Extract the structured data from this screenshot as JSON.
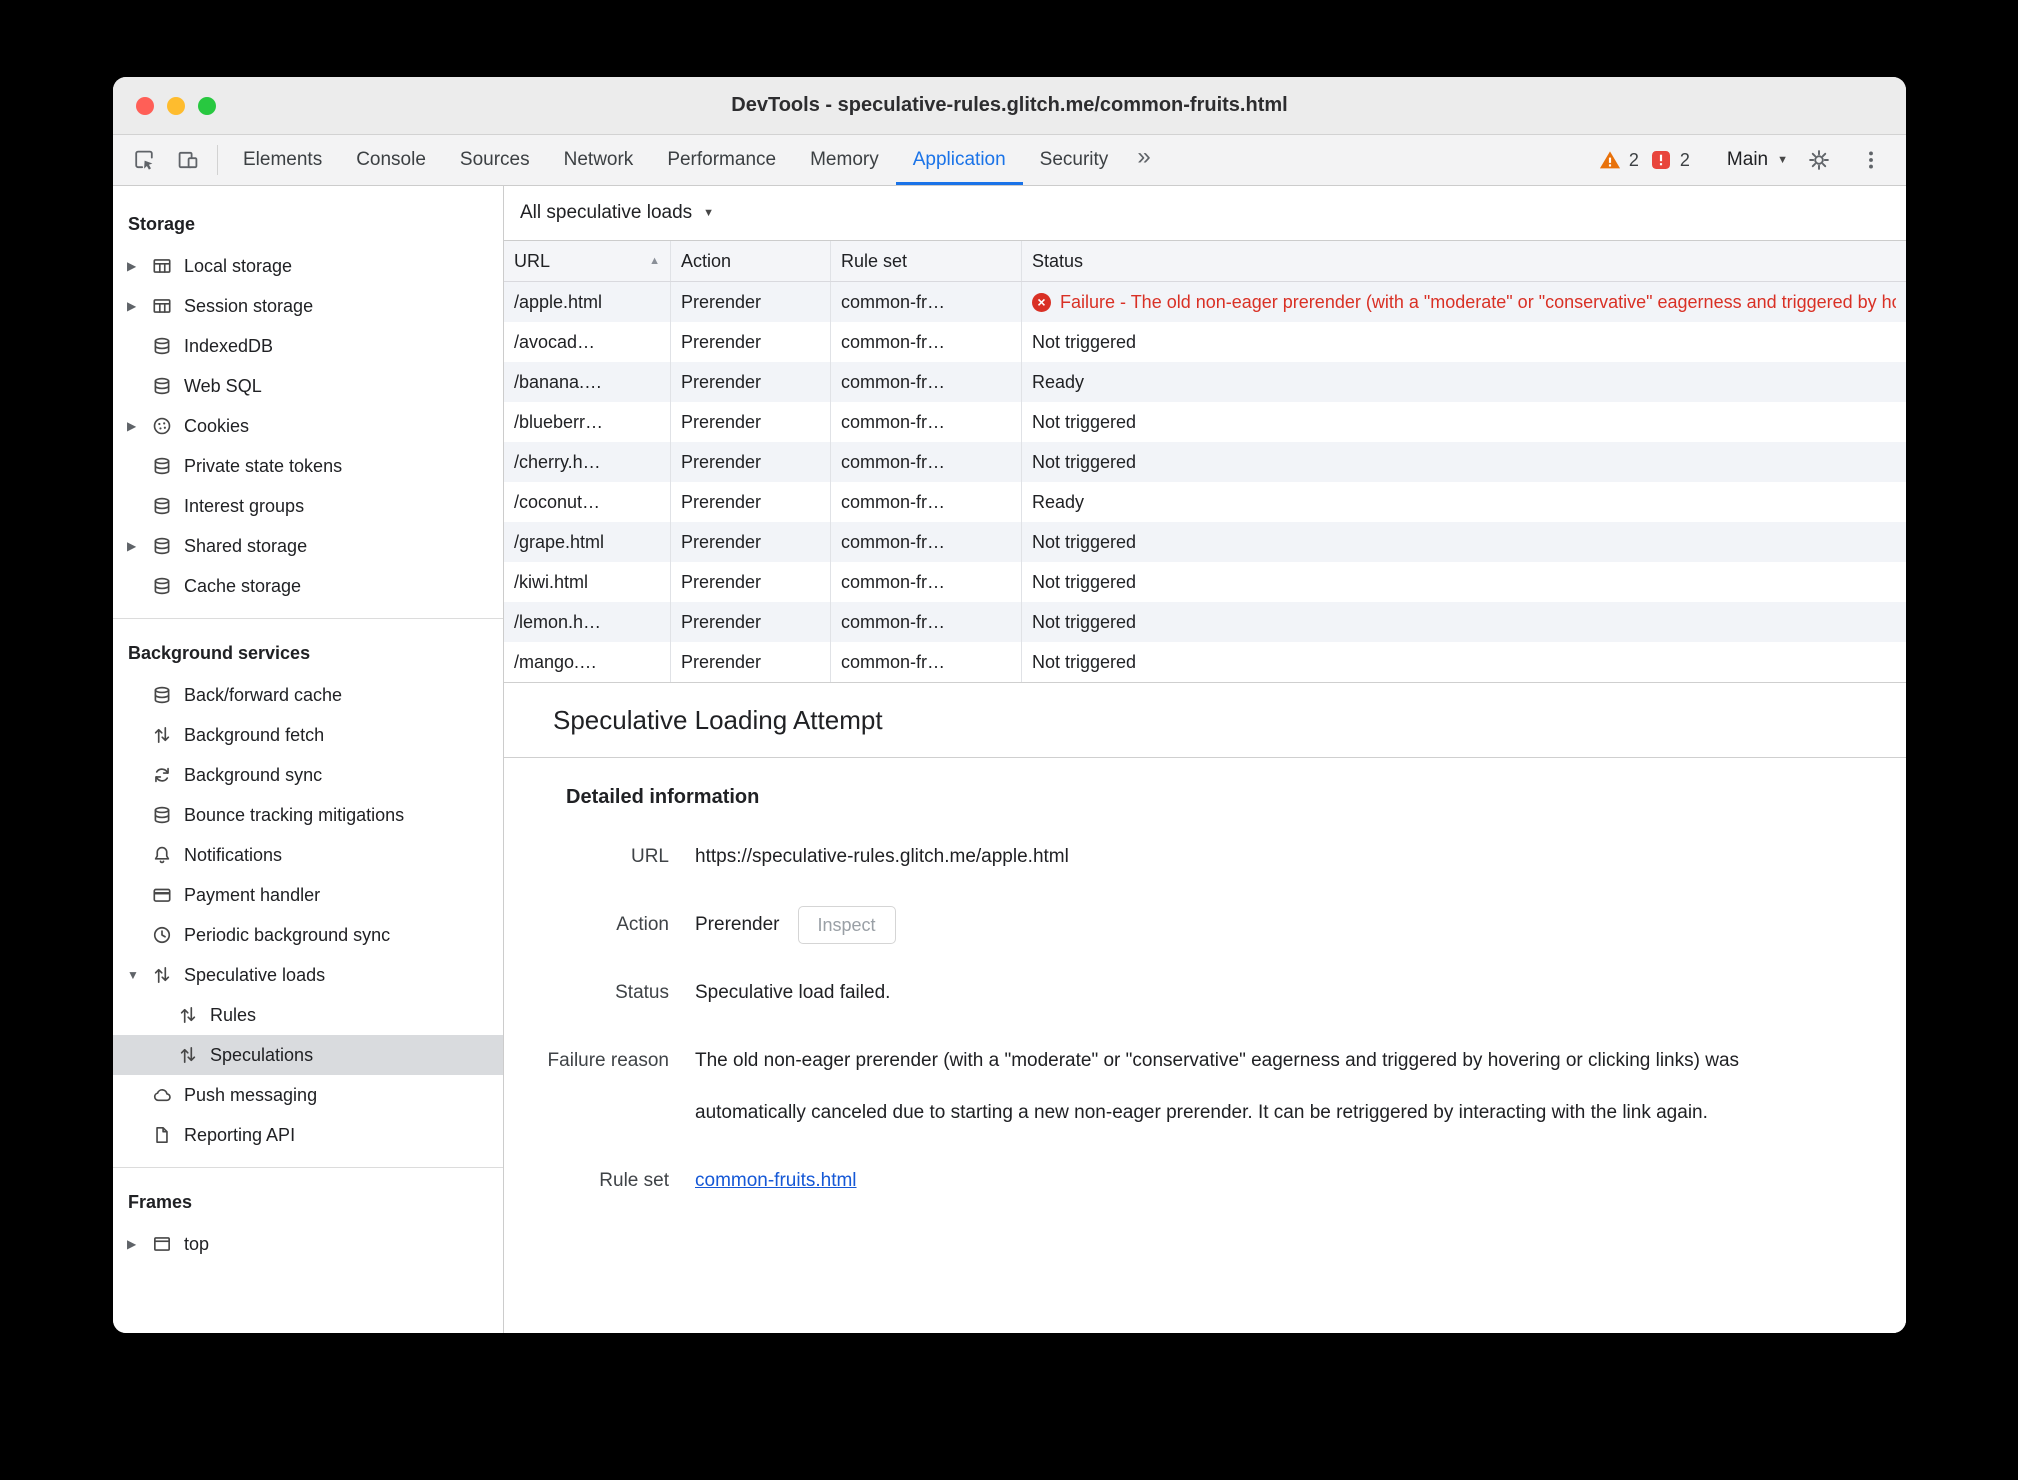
{
  "window": {
    "title": "DevTools - speculative-rules.glitch.me/common-fruits.html"
  },
  "toolbar": {
    "tabs": [
      "Elements",
      "Console",
      "Sources",
      "Network",
      "Performance",
      "Memory",
      "Application",
      "Security"
    ],
    "active_tab": "Application",
    "warning_count": "2",
    "issue_count": "2",
    "main_menu_label": "Main"
  },
  "icons": {
    "sort_ascending": "▲",
    "dropdown_caret": "▼",
    "collapsed_chevron": "▶",
    "expanded_chevron": "▼",
    "failure_x": "×",
    "overflow_chevron": "»",
    "main_caret": "▼"
  },
  "sidebar": {
    "storage": {
      "header": "Storage",
      "items": [
        {
          "label": "Local storage",
          "icon": "table-icon"
        },
        {
          "label": "Session storage",
          "icon": "table-icon"
        },
        {
          "label": "IndexedDB",
          "icon": "database-icon"
        },
        {
          "label": "Web SQL",
          "icon": "database-icon"
        },
        {
          "label": "Cookies",
          "icon": "cookie-icon"
        },
        {
          "label": "Private state tokens",
          "icon": "database-icon"
        },
        {
          "label": "Interest groups",
          "icon": "database-icon"
        },
        {
          "label": "Shared storage",
          "icon": "database-icon"
        },
        {
          "label": "Cache storage",
          "icon": "database-icon"
        }
      ]
    },
    "background_services": {
      "header": "Background services",
      "items": [
        {
          "label": "Back/forward cache",
          "icon": "database-icon"
        },
        {
          "label": "Background fetch",
          "icon": "swap-arrows-icon"
        },
        {
          "label": "Background sync",
          "icon": "sync-icon"
        },
        {
          "label": "Bounce tracking mitigations",
          "icon": "database-icon"
        },
        {
          "label": "Notifications",
          "icon": "bell-icon"
        },
        {
          "label": "Payment handler",
          "icon": "payment-card-icon"
        },
        {
          "label": "Periodic background sync",
          "icon": "clock-icon"
        },
        {
          "label": "Speculative loads",
          "icon": "swap-arrows-icon"
        },
        {
          "label": "Rules",
          "icon": "swap-arrows-icon"
        },
        {
          "label": "Speculations",
          "icon": "swap-arrows-icon"
        },
        {
          "label": "Push messaging",
          "icon": "cloud-icon"
        },
        {
          "label": "Reporting API",
          "icon": "document-icon"
        }
      ],
      "selected_item": "Speculations"
    },
    "frames": {
      "header": "Frames",
      "items": [
        {
          "label": "top",
          "icon": "frame-icon"
        }
      ]
    }
  },
  "main": {
    "filter_label": "All speculative loads",
    "table": {
      "columns": [
        "URL",
        "Action",
        "Rule set",
        "Status"
      ],
      "rows": [
        {
          "url": "/apple.html",
          "action": "Prerender",
          "rule_set": "common-fr…",
          "status": "Failure - The old non-eager prerender (with a \"moderate\" or \"conservative\" eagerness and triggered by hovering or clicking links) was automatically canceled",
          "status_type": "failure"
        },
        {
          "url": "/avocad…",
          "action": "Prerender",
          "rule_set": "common-fr…",
          "status": "Not triggered",
          "status_type": "normal"
        },
        {
          "url": "/banana.…",
          "action": "Prerender",
          "rule_set": "common-fr…",
          "status": "Ready",
          "status_type": "normal"
        },
        {
          "url": "/blueberr…",
          "action": "Prerender",
          "rule_set": "common-fr…",
          "status": "Not triggered",
          "status_type": "normal"
        },
        {
          "url": "/cherry.h…",
          "action": "Prerender",
          "rule_set": "common-fr…",
          "status": "Not triggered",
          "status_type": "normal"
        },
        {
          "url": "/coconut…",
          "action": "Prerender",
          "rule_set": "common-fr…",
          "status": "Ready",
          "status_type": "normal"
        },
        {
          "url": "/grape.html",
          "action": "Prerender",
          "rule_set": "common-fr…",
          "status": "Not triggered",
          "status_type": "normal"
        },
        {
          "url": "/kiwi.html",
          "action": "Prerender",
          "rule_set": "common-fr…",
          "status": "Not triggered",
          "status_type": "normal"
        },
        {
          "url": "/lemon.h…",
          "action": "Prerender",
          "rule_set": "common-fr…",
          "status": "Not triggered",
          "status_type": "normal"
        },
        {
          "url": "/mango.…",
          "action": "Prerender",
          "rule_set": "common-fr…",
          "status": "Not triggered",
          "status_type": "normal"
        }
      ]
    },
    "details": {
      "section_title": "Speculative Loading Attempt",
      "heading": "Detailed information",
      "rows": {
        "url": {
          "label": "URL",
          "value": "https://speculative-rules.glitch.me/apple.html"
        },
        "action": {
          "label": "Action",
          "value": "Prerender",
          "button": "Inspect"
        },
        "status": {
          "label": "Status",
          "value": "Speculative load failed."
        },
        "failure_reason": {
          "label": "Failure reason",
          "value": "The old non-eager prerender (with a \"moderate\" or \"conservative\" eagerness and triggered by hovering or clicking links) was automatically canceled due to starting a new non-eager prerender. It can be retriggered by interacting with the link again."
        },
        "rule_set": {
          "label": "Rule set",
          "value": "common-fruits.html"
        }
      }
    }
  },
  "colors": {
    "accent_blue": "#1a73e8",
    "link_blue": "#1558d6",
    "failure_red": "#d93025",
    "warning_orange": "#e8710a",
    "issue_red": "#e8453c",
    "selected_sidebar_gray": "#d9dbde",
    "row_stripe": "#f2f4f8"
  }
}
